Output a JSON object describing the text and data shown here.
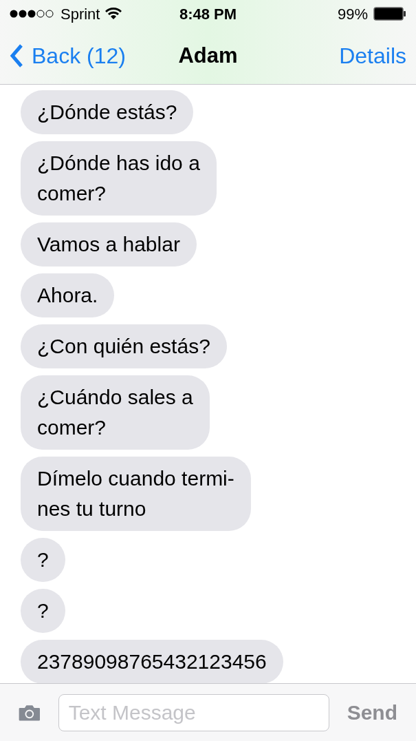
{
  "status_bar": {
    "carrier": "Sprint",
    "time": "8:48 PM",
    "battery": "99%"
  },
  "nav": {
    "back": "Back (12)",
    "title": "Adam",
    "details": "Details"
  },
  "messages": [
    {
      "text": "¿Dónde estás?"
    },
    {
      "text": "¿Dónde has ido a\ncomer?"
    },
    {
      "text": "Vamos a hablar"
    },
    {
      "text": "Ahora."
    },
    {
      "text": "¿Con quién estás?"
    },
    {
      "text": "¿Cuándo sales a\ncomer?"
    },
    {
      "text": "Dímelo cuando termi-\nnes tu turno"
    },
    {
      "text": "?"
    },
    {
      "text": "?"
    },
    {
      "text": "23789098765432123456"
    }
  ],
  "composer": {
    "placeholder": "Text Message",
    "send": "Send"
  }
}
